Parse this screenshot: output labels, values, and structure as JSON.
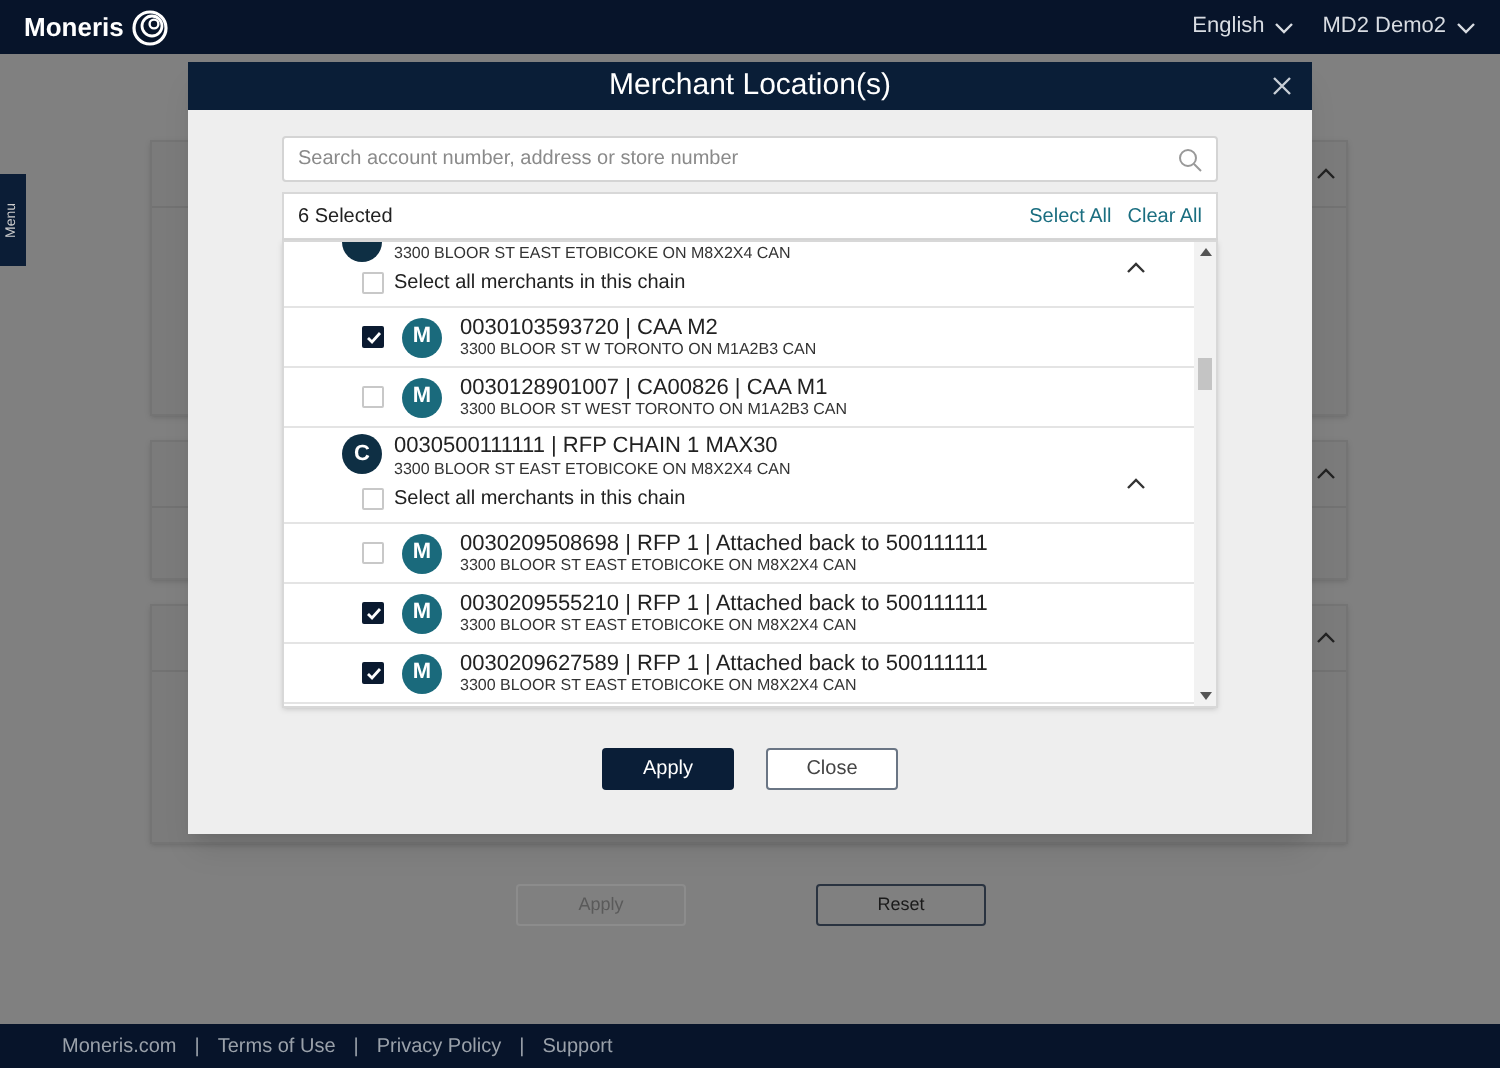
{
  "header": {
    "brand": "Moneris",
    "language": "English",
    "user": "MD2 Demo2"
  },
  "side_tab": {
    "label": "Menu"
  },
  "cards": [
    {
      "expanded": true
    },
    {
      "expanded": true
    },
    {
      "expanded": true
    }
  ],
  "page_buttons": [
    {
      "label": "Apply",
      "disabled": true
    },
    {
      "label": "Reset",
      "disabled": false
    }
  ],
  "footer": {
    "links": [
      "Moneris.com",
      "Terms of Use",
      "Privacy Policy",
      "Support"
    ],
    "separators": [
      "|",
      "|",
      "|"
    ]
  },
  "dialog": {
    "title": "Merchant Location(s)",
    "search": {
      "placeholder": "Search account number, address or store number"
    },
    "selected_count": "6 Selected",
    "select_all": "Select All",
    "clear_all": "Clear All",
    "chains": [
      {
        "address": "3300 BLOOR ST EAST ETOBICOKE ON M8X2X4 CAN",
        "expanded": true,
        "select_all_label": "Select all merchants in this chain",
        "select_all_checked": false,
        "merchants": [
          {
            "avatar": "M",
            "name": "0030103593720 | CAA M2",
            "address": "3300 BLOOR ST W TORONTO ON M1A2B3 CAN",
            "checked": true
          },
          {
            "avatar": "M",
            "name": "0030128901007 | CA00826 | CAA M1",
            "address": "3300 BLOOR ST WEST TORONTO ON M1A2B3 CAN",
            "checked": false
          }
        ]
      },
      {
        "name": "0030500111111 | RFP CHAIN 1 MAX30",
        "address": "3300 BLOOR ST EAST ETOBICOKE ON M8X2X4 CAN",
        "avatar": "C",
        "expanded": true,
        "select_all_label": "Select all merchants in this chain",
        "select_all_checked": false,
        "merchants": [
          {
            "avatar": "M",
            "name": "0030209508698 | RFP 1 | Attached back to 500111111",
            "address": "3300 BLOOR ST EAST ETOBICOKE ON M8X2X4 CAN",
            "checked": false
          },
          {
            "avatar": "M",
            "name": "0030209555210 | RFP 1 | Attached back to 500111111",
            "address": "3300 BLOOR ST EAST ETOBICOKE ON M8X2X4 CAN",
            "checked": true
          },
          {
            "avatar": "M",
            "name": "0030209627589 | RFP 1 | Attached back to 500111111",
            "address": "3300 BLOOR ST EAST ETOBICOKE ON M8X2X4 CAN",
            "checked": true
          }
        ]
      }
    ],
    "buttons": [
      {
        "kind": "primary",
        "label": "Apply"
      },
      {
        "kind": "secondary",
        "label": "Close"
      }
    ]
  }
}
